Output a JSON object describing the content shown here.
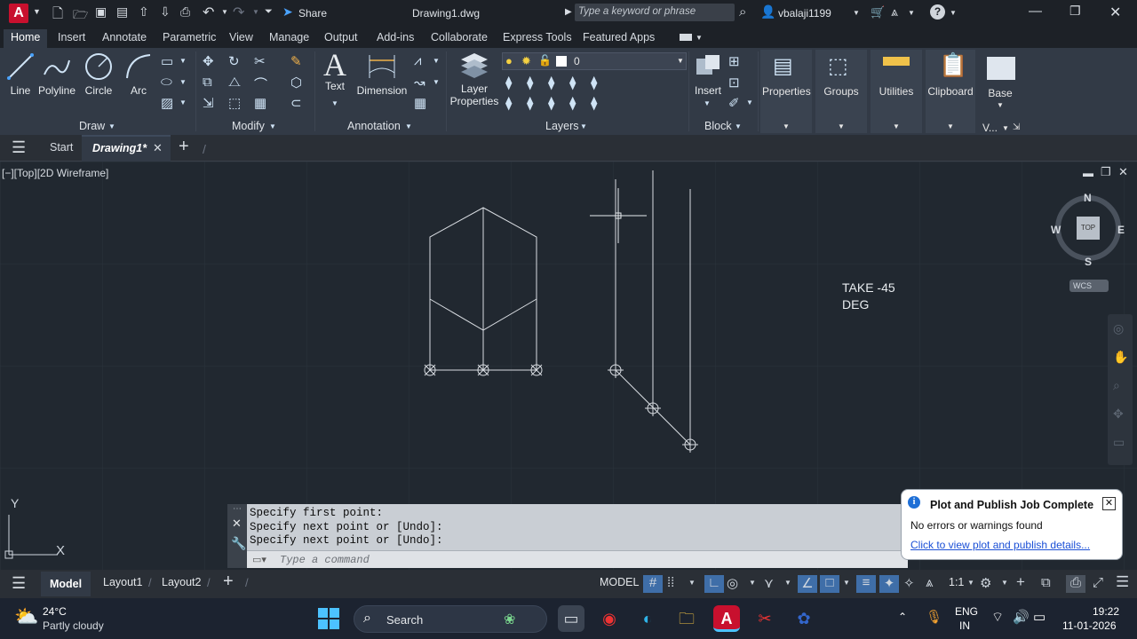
{
  "title_bar": {
    "app_letter": "A",
    "share_label": "Share",
    "document_title": "Drawing1.dwg",
    "search_placeholder": "Type a keyword or phrase",
    "username": "vbalaji1199"
  },
  "menu_tabs": [
    "Home",
    "Insert",
    "Annotate",
    "Parametric",
    "View",
    "Manage",
    "Output",
    "Add-ins",
    "Collaborate",
    "Express Tools",
    "Featured Apps"
  ],
  "ribbon": {
    "draw": {
      "line": "Line",
      "polyline": "Polyline",
      "circle": "Circle",
      "arc": "Arc",
      "panel": "Draw"
    },
    "modify": {
      "panel": "Modify"
    },
    "annotation": {
      "text": "Text",
      "dimension": "Dimension",
      "panel": "Annotation"
    },
    "layers": {
      "layer_properties_line1": "Layer",
      "layer_properties_line2": "Properties",
      "current_layer": "0",
      "panel": "Layers"
    },
    "block": {
      "insert": "Insert",
      "panel": "Block"
    },
    "properties": "Properties",
    "groups": "Groups",
    "utilities": "Utilities",
    "clipboard": "Clipboard",
    "base": "Base",
    "view_short": "V..."
  },
  "doc_tabs": {
    "start": "Start",
    "drawing": "Drawing1*"
  },
  "viewport": {
    "label": "[−][Top][2D Wireframe]",
    "viewcube": {
      "top": "TOP",
      "n": "N",
      "s": "S",
      "e": "E",
      "w": "W",
      "wcs": "WCS"
    },
    "note_line1": "TAKE -45",
    "note_line2": "DEG",
    "ucs_x": "X",
    "ucs_y": "Y"
  },
  "command": {
    "history": [
      "Specify first point:",
      "Specify next point or [Undo]:",
      "Specify next point or [Undo]:"
    ],
    "placeholder": "Type a command"
  },
  "notification": {
    "title": "Plot and Publish Job Complete",
    "message": "No errors or warnings found",
    "link": "Click to view plot and publish details..."
  },
  "layout_tabs": {
    "model": "Model",
    "layout1": "Layout1",
    "layout2": "Layout2"
  },
  "status": {
    "model": "MODEL",
    "scale": "1:1"
  },
  "taskbar": {
    "temperature": "24°C",
    "weather": "Partly cloudy",
    "search": "Search",
    "lang_line1": "ENG",
    "lang_line2": "IN",
    "time": "19:22",
    "date": "11-01-2026"
  },
  "colors": {
    "accent": "#1e6fd6",
    "autocad_red": "#c8102e",
    "drawing_lines": "#d9dde2",
    "canvas_bg": "#212830"
  }
}
